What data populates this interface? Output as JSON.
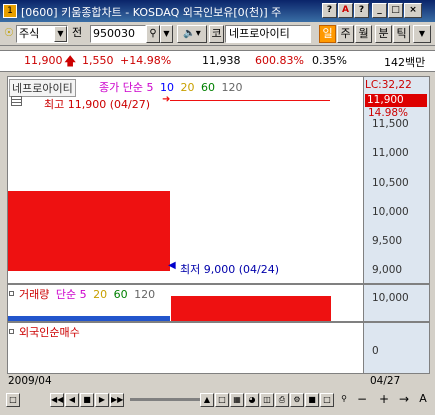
{
  "window": {
    "title": "[0600] 키움종합차트 - KOSDAQ 외국인보유[0(천)] 주",
    "icon_label": "1",
    "buttons": [
      "?",
      "A",
      "?",
      "_",
      "□",
      "×"
    ]
  },
  "toolbar": {
    "market_type": "주식",
    "mode": "전",
    "code": "950030",
    "stock_prefix": "코",
    "stock_name": "네프로아이티",
    "periods": [
      "일",
      "주",
      "월",
      "분",
      "틱"
    ],
    "active_period": "일"
  },
  "infobar": {
    "price": "11,900",
    "change": "1,550",
    "change_pct": "+14.98%",
    "prev": "11,938",
    "rate": "600.83%",
    "pct2": "0.35%",
    "volume": "142백만"
  },
  "price_pane": {
    "legend_name": "네프로아이티",
    "legend_items": [
      {
        "text": "종가 단순",
        "color": "#cc00cc"
      },
      {
        "text": "5",
        "color": "#cc00cc"
      },
      {
        "text": "10",
        "color": "#0000ff"
      },
      {
        "text": "20",
        "color": "#c8a000"
      },
      {
        "text": "60",
        "color": "#008000"
      },
      {
        "text": "120",
        "color": "#666666"
      }
    ],
    "high_label": "최고 11,900 (04/27)",
    "low_label": "최저 9,000 (04/24)",
    "lc_label": "LC:32,22",
    "current_price": "11,900",
    "current_pct": "14.98%",
    "y_ticks": [
      "11,500",
      "11,000",
      "10,500",
      "10,000",
      "9,500",
      "9,000"
    ]
  },
  "volume_pane": {
    "legend_items": [
      {
        "text": "거래량",
        "color": "#cc0000"
      },
      {
        "text": "단순",
        "color": "#cc00cc"
      },
      {
        "text": "5",
        "color": "#cc00cc"
      },
      {
        "text": "20",
        "color": "#c8a000"
      },
      {
        "text": "60",
        "color": "#008000"
      },
      {
        "text": "120",
        "color": "#666666"
      }
    ],
    "y_ticks": [
      "10,000"
    ]
  },
  "foreign_pane": {
    "legend": "외국인순매수",
    "y_ticks": [
      "0"
    ]
  },
  "xaxis": {
    "left_date": "2009/04",
    "right_date": "04/27"
  },
  "colors": {
    "candle_red": "#ee1111",
    "volume_blue": "#2255cc",
    "axis_bg": "#dde6f0"
  }
}
